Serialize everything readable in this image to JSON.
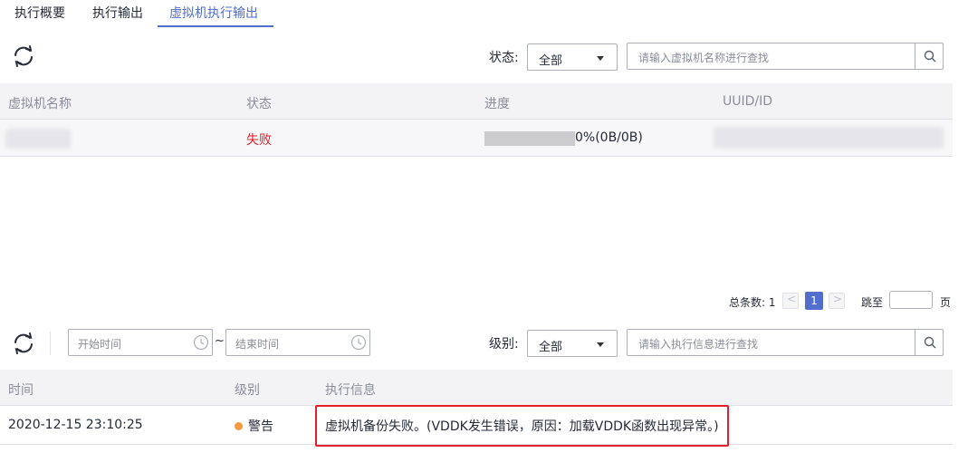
{
  "tabs": [
    {
      "label": "执行概要"
    },
    {
      "label": "执行输出"
    },
    {
      "label": "虚拟机执行输出"
    }
  ],
  "vm_section": {
    "status_label": "状态:",
    "status_select": "全部",
    "search_placeholder": "请输入虚拟机名称进行查找",
    "columns": [
      "虚拟机名称",
      "状态",
      "进度",
      "UUID/ID"
    ],
    "rows": [
      {
        "status": "失败",
        "progress_text": "0%(0B/0B)",
        "progress": 0
      }
    ],
    "pagination": {
      "total_label": "总条数: 1",
      "prev": "<",
      "current_page": "1",
      "next": ">",
      "jump_label": "跳至",
      "page_label": "页"
    }
  },
  "log_section": {
    "start_placeholder": "开始时间",
    "separator": "~",
    "end_placeholder": "结束时间",
    "level_label": "级别:",
    "level_select": "全部",
    "search_placeholder": "请输入执行信息进行查找",
    "columns": [
      "时间",
      "级别",
      "执行信息"
    ],
    "rows": [
      {
        "time": "2020-12-15 23:10:25",
        "level": "警告",
        "message": "虚拟机备份失败。(VDDK发生错误，原因：加载VDDK函数出现异常。)"
      }
    ]
  },
  "colors": {
    "accent": "#526ecc",
    "fail": "#e0202a",
    "warning": "#fa9841",
    "highlight_border": "#e0202a"
  }
}
